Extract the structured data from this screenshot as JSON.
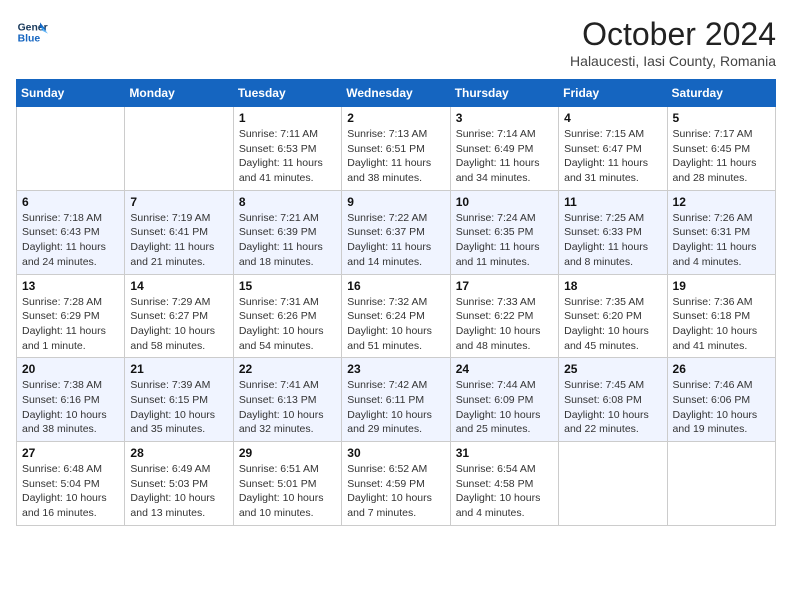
{
  "header": {
    "logo_line1": "General",
    "logo_line2": "Blue",
    "month": "October 2024",
    "location": "Halaucesti, Iasi County, Romania"
  },
  "weekdays": [
    "Sunday",
    "Monday",
    "Tuesday",
    "Wednesday",
    "Thursday",
    "Friday",
    "Saturday"
  ],
  "weeks": [
    [
      {
        "day": "",
        "info": ""
      },
      {
        "day": "",
        "info": ""
      },
      {
        "day": "1",
        "info": "Sunrise: 7:11 AM\nSunset: 6:53 PM\nDaylight: 11 hours and 41 minutes."
      },
      {
        "day": "2",
        "info": "Sunrise: 7:13 AM\nSunset: 6:51 PM\nDaylight: 11 hours and 38 minutes."
      },
      {
        "day": "3",
        "info": "Sunrise: 7:14 AM\nSunset: 6:49 PM\nDaylight: 11 hours and 34 minutes."
      },
      {
        "day": "4",
        "info": "Sunrise: 7:15 AM\nSunset: 6:47 PM\nDaylight: 11 hours and 31 minutes."
      },
      {
        "day": "5",
        "info": "Sunrise: 7:17 AM\nSunset: 6:45 PM\nDaylight: 11 hours and 28 minutes."
      }
    ],
    [
      {
        "day": "6",
        "info": "Sunrise: 7:18 AM\nSunset: 6:43 PM\nDaylight: 11 hours and 24 minutes."
      },
      {
        "day": "7",
        "info": "Sunrise: 7:19 AM\nSunset: 6:41 PM\nDaylight: 11 hours and 21 minutes."
      },
      {
        "day": "8",
        "info": "Sunrise: 7:21 AM\nSunset: 6:39 PM\nDaylight: 11 hours and 18 minutes."
      },
      {
        "day": "9",
        "info": "Sunrise: 7:22 AM\nSunset: 6:37 PM\nDaylight: 11 hours and 14 minutes."
      },
      {
        "day": "10",
        "info": "Sunrise: 7:24 AM\nSunset: 6:35 PM\nDaylight: 11 hours and 11 minutes."
      },
      {
        "day": "11",
        "info": "Sunrise: 7:25 AM\nSunset: 6:33 PM\nDaylight: 11 hours and 8 minutes."
      },
      {
        "day": "12",
        "info": "Sunrise: 7:26 AM\nSunset: 6:31 PM\nDaylight: 11 hours and 4 minutes."
      }
    ],
    [
      {
        "day": "13",
        "info": "Sunrise: 7:28 AM\nSunset: 6:29 PM\nDaylight: 11 hours and 1 minute."
      },
      {
        "day": "14",
        "info": "Sunrise: 7:29 AM\nSunset: 6:27 PM\nDaylight: 10 hours and 58 minutes."
      },
      {
        "day": "15",
        "info": "Sunrise: 7:31 AM\nSunset: 6:26 PM\nDaylight: 10 hours and 54 minutes."
      },
      {
        "day": "16",
        "info": "Sunrise: 7:32 AM\nSunset: 6:24 PM\nDaylight: 10 hours and 51 minutes."
      },
      {
        "day": "17",
        "info": "Sunrise: 7:33 AM\nSunset: 6:22 PM\nDaylight: 10 hours and 48 minutes."
      },
      {
        "day": "18",
        "info": "Sunrise: 7:35 AM\nSunset: 6:20 PM\nDaylight: 10 hours and 45 minutes."
      },
      {
        "day": "19",
        "info": "Sunrise: 7:36 AM\nSunset: 6:18 PM\nDaylight: 10 hours and 41 minutes."
      }
    ],
    [
      {
        "day": "20",
        "info": "Sunrise: 7:38 AM\nSunset: 6:16 PM\nDaylight: 10 hours and 38 minutes."
      },
      {
        "day": "21",
        "info": "Sunrise: 7:39 AM\nSunset: 6:15 PM\nDaylight: 10 hours and 35 minutes."
      },
      {
        "day": "22",
        "info": "Sunrise: 7:41 AM\nSunset: 6:13 PM\nDaylight: 10 hours and 32 minutes."
      },
      {
        "day": "23",
        "info": "Sunrise: 7:42 AM\nSunset: 6:11 PM\nDaylight: 10 hours and 29 minutes."
      },
      {
        "day": "24",
        "info": "Sunrise: 7:44 AM\nSunset: 6:09 PM\nDaylight: 10 hours and 25 minutes."
      },
      {
        "day": "25",
        "info": "Sunrise: 7:45 AM\nSunset: 6:08 PM\nDaylight: 10 hours and 22 minutes."
      },
      {
        "day": "26",
        "info": "Sunrise: 7:46 AM\nSunset: 6:06 PM\nDaylight: 10 hours and 19 minutes."
      }
    ],
    [
      {
        "day": "27",
        "info": "Sunrise: 6:48 AM\nSunset: 5:04 PM\nDaylight: 10 hours and 16 minutes."
      },
      {
        "day": "28",
        "info": "Sunrise: 6:49 AM\nSunset: 5:03 PM\nDaylight: 10 hours and 13 minutes."
      },
      {
        "day": "29",
        "info": "Sunrise: 6:51 AM\nSunset: 5:01 PM\nDaylight: 10 hours and 10 minutes."
      },
      {
        "day": "30",
        "info": "Sunrise: 6:52 AM\nSunset: 4:59 PM\nDaylight: 10 hours and 7 minutes."
      },
      {
        "day": "31",
        "info": "Sunrise: 6:54 AM\nSunset: 4:58 PM\nDaylight: 10 hours and 4 minutes."
      },
      {
        "day": "",
        "info": ""
      },
      {
        "day": "",
        "info": ""
      }
    ]
  ]
}
